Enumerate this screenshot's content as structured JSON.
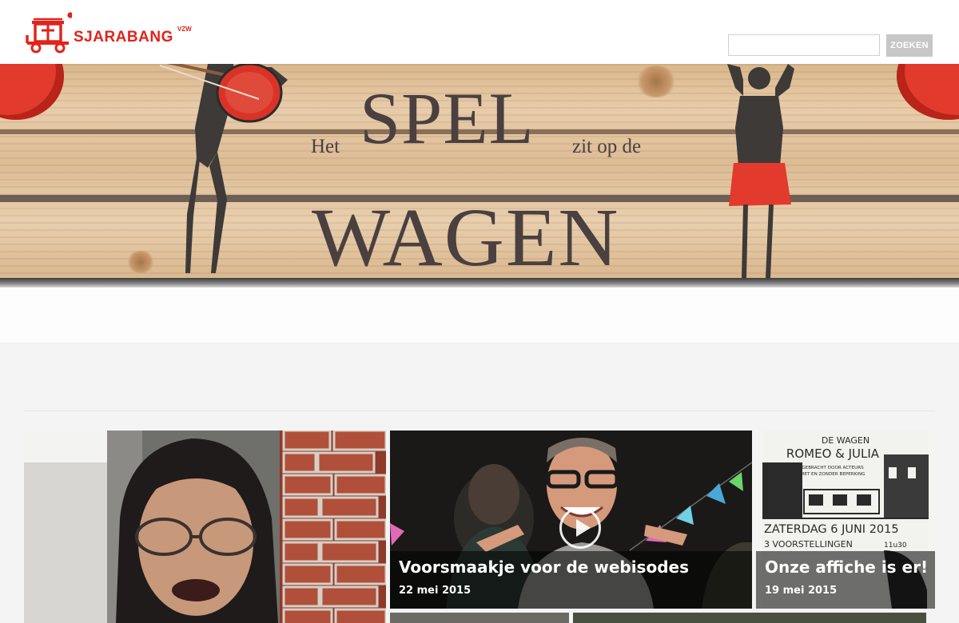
{
  "header": {
    "brand": "SJARABANG",
    "brand_suffix": "VZW",
    "logo_icon": "wagon-logo-icon",
    "brand_color": "#e2231a"
  },
  "search": {
    "value": "",
    "placeholder": "",
    "button_label": "ZOEKEN"
  },
  "banner": {
    "line1_prefix": "Het",
    "line1_big": "SPEL",
    "line1_suffix": "zit op de",
    "line2": "WAGEN"
  },
  "tiles": [
    {
      "title": "",
      "date": ""
    },
    {
      "title": "Voorsmaakje voor de webisodes",
      "date": "22 mei 2015",
      "icon": "play-icon"
    },
    {
      "title": "Onze affiche is er!",
      "date": "19 mei 2015"
    }
  ],
  "poster": {
    "line1": "DE WAGEN",
    "line2": "ROMEO & JULIA",
    "line3": "GEBRACHT DOOR ACTEURS",
    "line4": "MET EN ZONDER BEPERKING",
    "line5": "ZATERDAG 6 JUNI 2015",
    "line6": "3 VOORSTELLINGEN",
    "line7": "11u30"
  }
}
